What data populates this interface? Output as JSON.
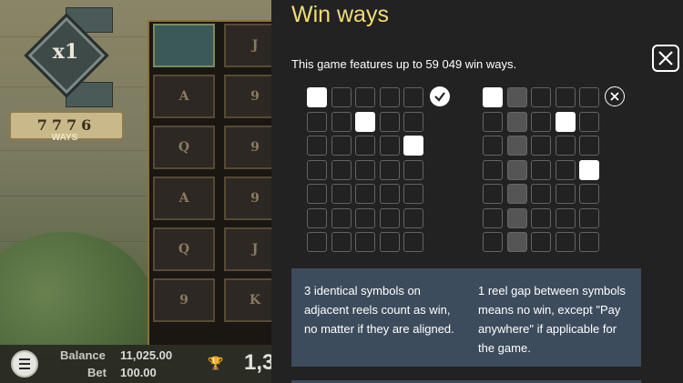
{
  "game": {
    "multiplier": "x1",
    "ways_count": "7776",
    "ways_label": "WAYS",
    "reel_symbols": [
      [
        "",
        "J"
      ],
      [
        "A",
        "9"
      ],
      [
        "Q",
        "9"
      ],
      [
        "A",
        "9"
      ],
      [
        "Q",
        "J"
      ],
      [
        "9",
        "K"
      ]
    ]
  },
  "hud": {
    "balance_label": "Balance",
    "balance_value": "11,025.00",
    "bet_label": "Bet",
    "bet_value": "100.00",
    "win_partial": "1,3"
  },
  "panel": {
    "title": "Win ways",
    "intro": "This game features up to 59 049 win ways.",
    "close_icon": "close-icon",
    "left_example": {
      "verdict_icon": "checkmark-icon",
      "highlighted": [
        [
          0,
          0
        ],
        [
          1,
          2
        ],
        [
          2,
          4
        ]
      ]
    },
    "right_example": {
      "verdict_icon": "cross-icon",
      "highlighted": [
        [
          0,
          0
        ],
        [
          1,
          3
        ],
        [
          3,
          4
        ]
      ],
      "gap_column": 1
    },
    "left_note": "3 identical symbols on adjacent reels count as win, no matter if they are aligned.",
    "right_note": "1 reel gap between symbols means no win, except \"Pay anywhere\" if applicable for the game."
  },
  "colors": {
    "title": "#f3dd72",
    "panel_bg": "#222222",
    "info_box": "#3d4c5c"
  }
}
